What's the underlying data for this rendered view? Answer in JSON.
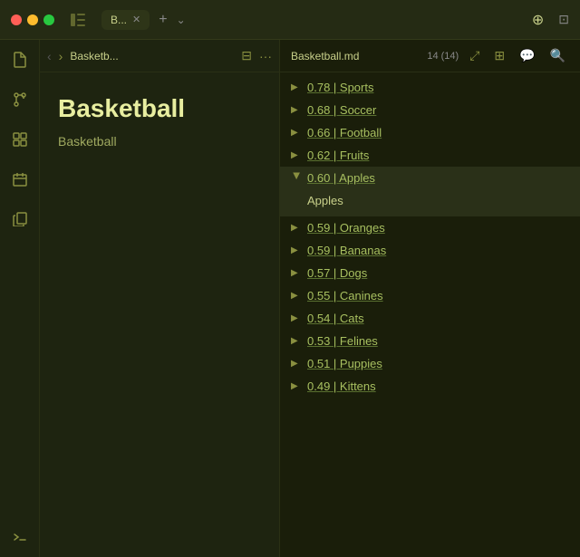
{
  "titlebar": {
    "tab_label": "B...",
    "tab_close": "✕",
    "tab_add": "+",
    "tab_chevron": "⌄"
  },
  "editor_nav": {
    "back_arrow": "‹",
    "forward_arrow": "›",
    "breadcrumb": "Basketb...",
    "book_icon": "📖",
    "more_icon": "···"
  },
  "editor": {
    "title": "Basketball",
    "subtitle": "Basketball"
  },
  "results_header": {
    "filename": "Basketball.md",
    "count": "14 (14)"
  },
  "results": [
    {
      "id": 1,
      "score": "0.78",
      "label": "Sports",
      "expanded": false,
      "content": ""
    },
    {
      "id": 2,
      "score": "0.68",
      "label": "Soccer",
      "expanded": false,
      "content": ""
    },
    {
      "id": 3,
      "score": "0.66",
      "label": "Football",
      "expanded": false,
      "content": ""
    },
    {
      "id": 4,
      "score": "0.62",
      "label": "Fruits",
      "expanded": false,
      "content": ""
    },
    {
      "id": 5,
      "score": "0.60",
      "label": "Apples",
      "expanded": true,
      "content": "Apples"
    },
    {
      "id": 6,
      "score": "0.59",
      "label": "Oranges",
      "expanded": false,
      "content": ""
    },
    {
      "id": 7,
      "score": "0.59",
      "label": "Bananas",
      "expanded": false,
      "content": ""
    },
    {
      "id": 8,
      "score": "0.57",
      "label": "Dogs",
      "expanded": false,
      "content": ""
    },
    {
      "id": 9,
      "score": "0.55",
      "label": "Canines",
      "expanded": false,
      "content": ""
    },
    {
      "id": 10,
      "score": "0.54",
      "label": "Cats",
      "expanded": false,
      "content": ""
    },
    {
      "id": 11,
      "score": "0.53",
      "label": "Felines",
      "expanded": false,
      "content": ""
    },
    {
      "id": 12,
      "score": "0.51",
      "label": "Puppies",
      "expanded": false,
      "content": ""
    },
    {
      "id": 13,
      "score": "0.49",
      "label": "Kittens",
      "expanded": false,
      "content": ""
    }
  ]
}
